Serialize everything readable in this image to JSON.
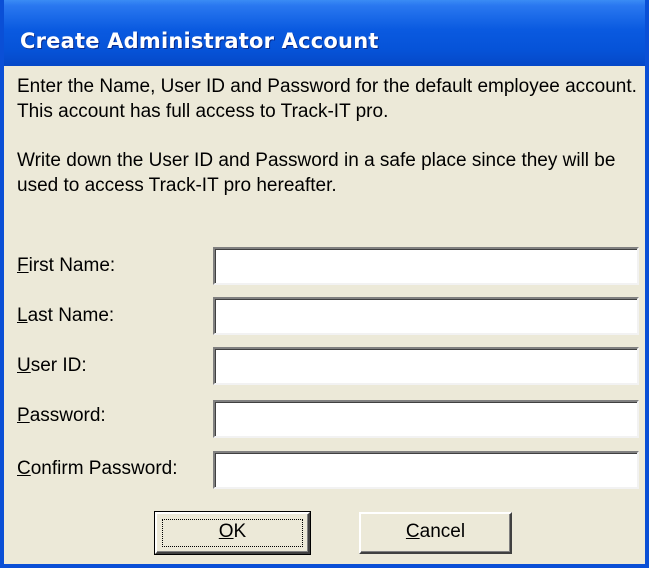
{
  "dialog": {
    "title": "Create Administrator Account",
    "description_1": "Enter the Name, User ID and Password for the default employee account.  This account has full access to Track-IT pro.",
    "description_2": "Write down the User ID and Password in a safe place since they will be used to access Track-IT pro hereafter."
  },
  "fields": {
    "first_name": {
      "label_key": "F",
      "label_rest": "irst Name:",
      "value": ""
    },
    "last_name": {
      "label_key": "L",
      "label_rest": "ast Name:",
      "value": ""
    },
    "user_id": {
      "label_key": "U",
      "label_rest": "ser ID:",
      "value": ""
    },
    "password": {
      "label_key": "P",
      "label_rest": "assword:",
      "value": ""
    },
    "confirm_password": {
      "label_key": "C",
      "label_rest": "onfirm Password:",
      "value": ""
    }
  },
  "buttons": {
    "ok_key": "O",
    "ok_rest": "K",
    "cancel_key": "C",
    "cancel_rest": "ancel"
  },
  "colors": {
    "titlebar": "#0a5ae0",
    "dialog_background": "#ece9d8",
    "frame": "#0a4fd6"
  }
}
